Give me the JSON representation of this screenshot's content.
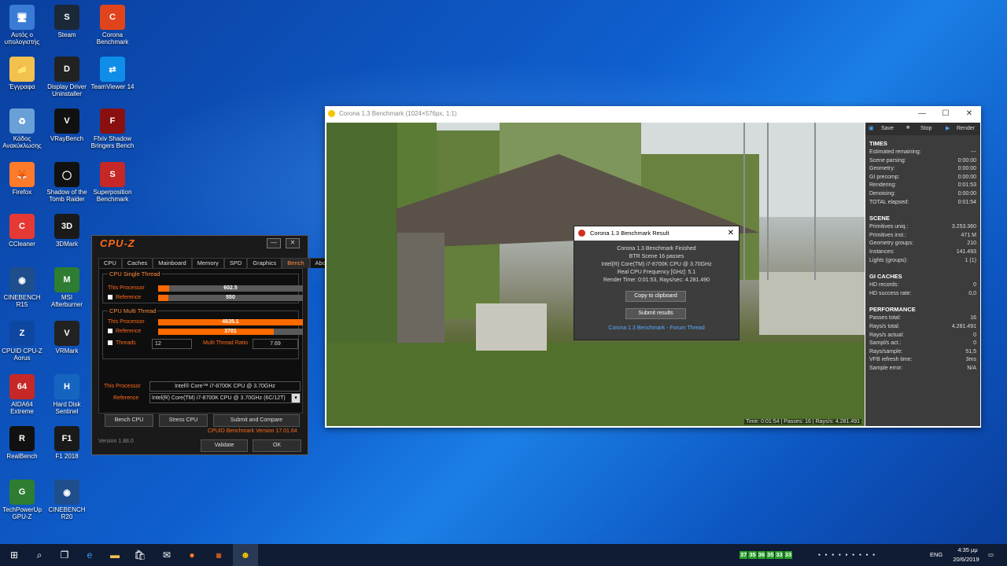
{
  "desktop": {
    "icons": [
      {
        "label": "Αυτός ο υπολογιστής"
      },
      {
        "label": "Steam"
      },
      {
        "label": "Corona Benchmark"
      },
      {
        "label": "Έγγραφα"
      },
      {
        "label": "Display Driver Uninstaller"
      },
      {
        "label": "TeamViewer 14"
      },
      {
        "label": "Κάδος Ανακύκλωσης"
      },
      {
        "label": "VRayBench"
      },
      {
        "label": "Ffxiv Shadow Bringers Bench"
      },
      {
        "label": "Firefox"
      },
      {
        "label": "Shadow of the Tomb Raider"
      },
      {
        "label": "Superposition Benchmark"
      },
      {
        "label": "CCleaner"
      },
      {
        "label": "3DMark"
      },
      {
        "label": "CINEBENCH R15"
      },
      {
        "label": "MSI Afterburner"
      },
      {
        "label": "CPUID CPU-Z Aorus"
      },
      {
        "label": "VRMark"
      },
      {
        "label": "AIDA64 Extreme"
      },
      {
        "label": "Hard Disk Sentinel"
      },
      {
        "label": "RealBench"
      },
      {
        "label": "F1 2018"
      },
      {
        "label": "TechPowerUp GPU-Z"
      },
      {
        "label": "CINEBENCH R20"
      }
    ]
  },
  "cpuz": {
    "logo": "CPU-Z",
    "tabs": [
      "CPU",
      "Caches",
      "Mainboard",
      "Memory",
      "SPD",
      "Graphics",
      "Bench",
      "About"
    ],
    "single_thread": {
      "title": "CPU Single Thread",
      "this_label": "This Processor",
      "this_value": "602.5",
      "this_fraction": 0.075,
      "ref_label": "Reference",
      "ref_value": "550",
      "ref_fraction": 0.068
    },
    "multi_thread": {
      "title": "CPU Multi Thread",
      "this_label": "This Processor",
      "this_value": "4635.1",
      "this_fraction": 1.0,
      "ref_label": "Reference",
      "ref_value": "3701",
      "ref_fraction": 0.8,
      "threads_label": "Threads",
      "threads_value": "12",
      "ratio_label": "Multi Thread Ratio",
      "ratio_value": "7.69"
    },
    "this_processor_label": "This Processor",
    "this_processor_value": "Intel® Core™ i7-8700K CPU @ 3.70GHz",
    "reference_label": "Reference",
    "reference_value": "Intel(R) Core(TM) i7-8700K CPU @ 3.70GHz (6C/12T)",
    "bench_button": "Bench CPU",
    "stress_button": "Stress CPU",
    "submit_button": "Submit and Compare",
    "bench_version": "CPUID Benchmark Version 17.01.64",
    "version": "Version 1.88.0",
    "validate_button": "Validate",
    "ok_button": "OK"
  },
  "corona": {
    "title": "Corona 1.3 Benchmark (1024×576px, 1:1)",
    "toolbar": {
      "save": "Save",
      "stop": "Stop",
      "render": "Render"
    },
    "status": "Time: 0:01:54 | Passes: 16 | Rays/s: 4.281.491",
    "times": {
      "header": "TIMES",
      "rows": [
        {
          "k": "Estimated remaining:",
          "v": "---"
        },
        {
          "k": "Scene parsing:",
          "v": "0:00:00"
        },
        {
          "k": "Geometry:",
          "v": "0:00:00"
        },
        {
          "k": "GI precomp:",
          "v": "0:00:00"
        },
        {
          "k": "Rendering:",
          "v": "0:01:53"
        },
        {
          "k": "Denoising:",
          "v": "0:00:00"
        },
        {
          "k": "TOTAL elapsed:",
          "v": "0:01:54"
        }
      ]
    },
    "scene": {
      "header": "SCENE",
      "rows": [
        {
          "k": "Primitives uniq.:",
          "v": "3.253.360"
        },
        {
          "k": "Primitives inst.:",
          "v": "471 M"
        },
        {
          "k": "Geometry groups:",
          "v": "210"
        },
        {
          "k": "Instances:",
          "v": "141.493"
        },
        {
          "k": "Lights (groups):",
          "v": "1 (1)"
        }
      ]
    },
    "gi": {
      "header": "GI CACHES",
      "rows": [
        {
          "k": "HD records:",
          "v": "0"
        },
        {
          "k": "HD success rate:",
          "v": "0,0"
        }
      ]
    },
    "perf": {
      "header": "PERFORMANCE",
      "rows": [
        {
          "k": "Passes total:",
          "v": "16"
        },
        {
          "k": "Rays/s total:",
          "v": "4.281.491"
        },
        {
          "k": "Rays/s actual:",
          "v": "0"
        },
        {
          "k": "Sampl/s act.:",
          "v": "0"
        },
        {
          "k": "Rays/sample:",
          "v": "51,5"
        },
        {
          "k": "VFB refresh time:",
          "v": "3ms"
        },
        {
          "k": "Sample error:",
          "v": "N/A"
        }
      ]
    }
  },
  "result_dialog": {
    "title": "Corona 1.3 Benchmark Result",
    "lines": [
      "Corona 1.3 Benchmark Finished",
      "BTR Scene 16 passes",
      "Intel(R) Core(TM) i7-8700K CPU @ 3.70GHz",
      "Real CPU Frequency [GHz]: 5.1",
      "Render Time: 0:01:53, Rays/sec: 4.281.490"
    ],
    "copy_button": "Copy to clipboard",
    "submit_button": "Submit results",
    "forum_link": "Corona 1.3 Benchmark - Forum Thread"
  },
  "taskbar": {
    "temps": [
      "37",
      "35",
      "36",
      "35",
      "33",
      "33"
    ],
    "lang": "ENG",
    "time": "4:35 μμ",
    "date": "20/6/2019"
  }
}
